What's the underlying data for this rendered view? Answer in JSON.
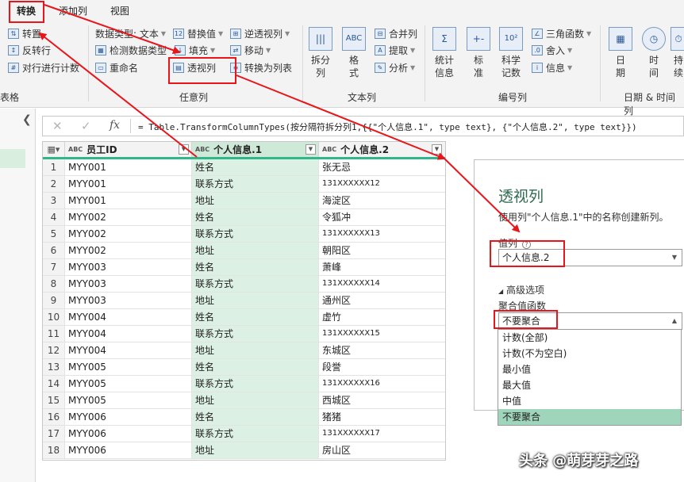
{
  "tabs": [
    "转换",
    "添加列",
    "视图"
  ],
  "ribbon": {
    "groups": {
      "table": "表格",
      "any_column": "任意列",
      "text_column": "文本列",
      "number_column": "编号列",
      "datetime_column": "日期 & 时间列"
    },
    "table_group": {
      "transpose": "转置",
      "reverse_rows": "反转行",
      "count_rows": "对行进行计数"
    },
    "any_column": {
      "data_type": "数据类型: 文本",
      "replace_values": "替换值",
      "unpivot": "逆透视列",
      "detect_type": "检测数据类型",
      "fill": "填充",
      "rename": "重命名",
      "move": "移动",
      "pivot": "透视列",
      "convert_list": "转换为列表"
    },
    "text_column": {
      "split": "拆分",
      "split2": "列",
      "format": "格",
      "format2": "式",
      "merge": "合并列",
      "extract": "提取",
      "parse": "分析",
      "split_icon": "|||",
      "format_icon": "ABC"
    },
    "number_column": {
      "statistics": "统计",
      "statistics2": "信息",
      "standard": "标",
      "standard2": "准",
      "scientific": "科学",
      "scientific2": "记数",
      "trig": "三角函数",
      "rounding": "舍入",
      "info": "信息",
      "sigma_icon": "Σ",
      "standard_icon": "+-",
      "sci_icon": "10²"
    },
    "datetime_column": {
      "date": "日",
      "date2": "期",
      "time": "时",
      "time2": "间",
      "duration": "持",
      "duration2": "续"
    }
  },
  "formula": {
    "text": "= Table.TransformColumnTypes(按分隔符拆分列1,{{\"个人信息.1\", type text}, {\"个人信息.2\", type text}})"
  },
  "grid": {
    "columns": [
      "员工ID",
      "个人信息.1",
      "个人信息.2"
    ],
    "type_icon": "ABC",
    "rows": [
      [
        "1",
        "MYY001",
        "姓名",
        "张无忌"
      ],
      [
        "2",
        "MYY001",
        "联系方式",
        "131XXXXXX12"
      ],
      [
        "3",
        "MYY001",
        "地址",
        "海淀区"
      ],
      [
        "4",
        "MYY002",
        "姓名",
        "令狐冲"
      ],
      [
        "5",
        "MYY002",
        "联系方式",
        "131XXXXXX13"
      ],
      [
        "6",
        "MYY002",
        "地址",
        "朝阳区"
      ],
      [
        "7",
        "MYY003",
        "姓名",
        "萧峰"
      ],
      [
        "8",
        "MYY003",
        "联系方式",
        "131XXXXXX14"
      ],
      [
        "9",
        "MYY003",
        "地址",
        "通州区"
      ],
      [
        "10",
        "MYY004",
        "姓名",
        "虚竹"
      ],
      [
        "11",
        "MYY004",
        "联系方式",
        "131XXXXXX15"
      ],
      [
        "12",
        "MYY004",
        "地址",
        "东城区"
      ],
      [
        "13",
        "MYY005",
        "姓名",
        "段誉"
      ],
      [
        "14",
        "MYY005",
        "联系方式",
        "131XXXXXX16"
      ],
      [
        "15",
        "MYY005",
        "地址",
        "西城区"
      ],
      [
        "16",
        "MYY006",
        "姓名",
        "猪猪"
      ],
      [
        "17",
        "MYY006",
        "联系方式",
        "131XXXXXX17"
      ],
      [
        "18",
        "MYY006",
        "地址",
        "房山区"
      ]
    ]
  },
  "dialog": {
    "title": "透视列",
    "description": "使用列\"个人信息.1\"中的名称创建新列。",
    "value_column_label": "值列",
    "value_column_value": "个人信息.2",
    "advanced": "高级选项",
    "agg_label": "聚合值函数",
    "agg_value": "不要聚合",
    "agg_options": [
      "计数(全部)",
      "计数(不为空白)",
      "最小值",
      "最大值",
      "中值",
      "不要聚合"
    ]
  },
  "watermark": "头条 @萌芽芽之路",
  "colors": {
    "accent": "#2fb68a",
    "selected_column": "#dcf0e4",
    "highlight": "#e8151b",
    "dialog_title": "#2e6b4f"
  }
}
